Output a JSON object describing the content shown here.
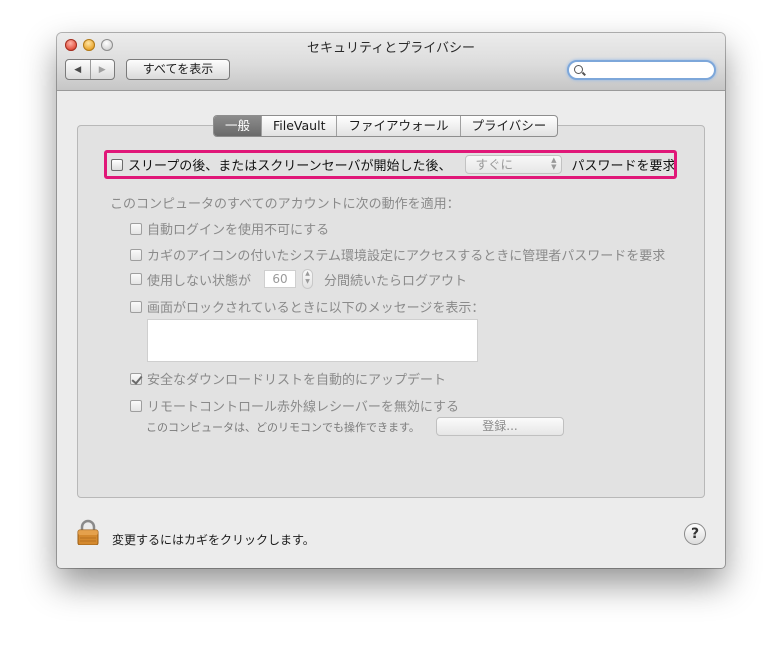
{
  "window": {
    "title": "セキュリティとプライバシー",
    "back_label": "◀",
    "forward_label": "▶",
    "show_all_label": "すべてを表示",
    "search_placeholder": ""
  },
  "tabs": [
    {
      "label": "一般",
      "active": true
    },
    {
      "label": "FileVault",
      "active": false
    },
    {
      "label": "ファイアウォール",
      "active": false
    },
    {
      "label": "プライバシー",
      "active": false
    }
  ],
  "general": {
    "sleep_password": {
      "prefix": "スリープの後、またはスクリーンセーバが開始した後、",
      "selected": "すぐに",
      "suffix": "パスワードを要求",
      "checked": false
    },
    "all_accounts_heading": "このコンピュータのすべてのアカウントに次の動作を適用：",
    "options": {
      "disable_auto_login": {
        "label": "自動ログインを使用不可にする",
        "checked": false
      },
      "require_admin_password": {
        "label": "カギのアイコンの付いたシステム環境設定にアクセスするときに管理者パスワードを要求",
        "checked": false
      },
      "logout_after": {
        "prefix": "使用しない状態が",
        "minutes": "60",
        "suffix": "分間続いたらログアウト",
        "checked": false
      },
      "show_message": {
        "label": "画面がロックされているときに以下のメッセージを表示：",
        "checked": false,
        "message": ""
      },
      "safe_downloads": {
        "label": "安全なダウンロードリストを自動的にアップデート",
        "checked": true
      },
      "disable_ir": {
        "label": "リモートコントロール赤外線レシーバーを無効にする",
        "checked": false
      }
    },
    "remote_note": "このコンピュータは、どのリモコンでも操作できます。",
    "register_label": "登録..."
  },
  "footer": {
    "lock_label": "変更するにはカギをクリックします。",
    "help_label": "?"
  },
  "colors": {
    "highlight": "#e01778",
    "window_bg": "#ececec",
    "search_focus": "#7da7da"
  }
}
